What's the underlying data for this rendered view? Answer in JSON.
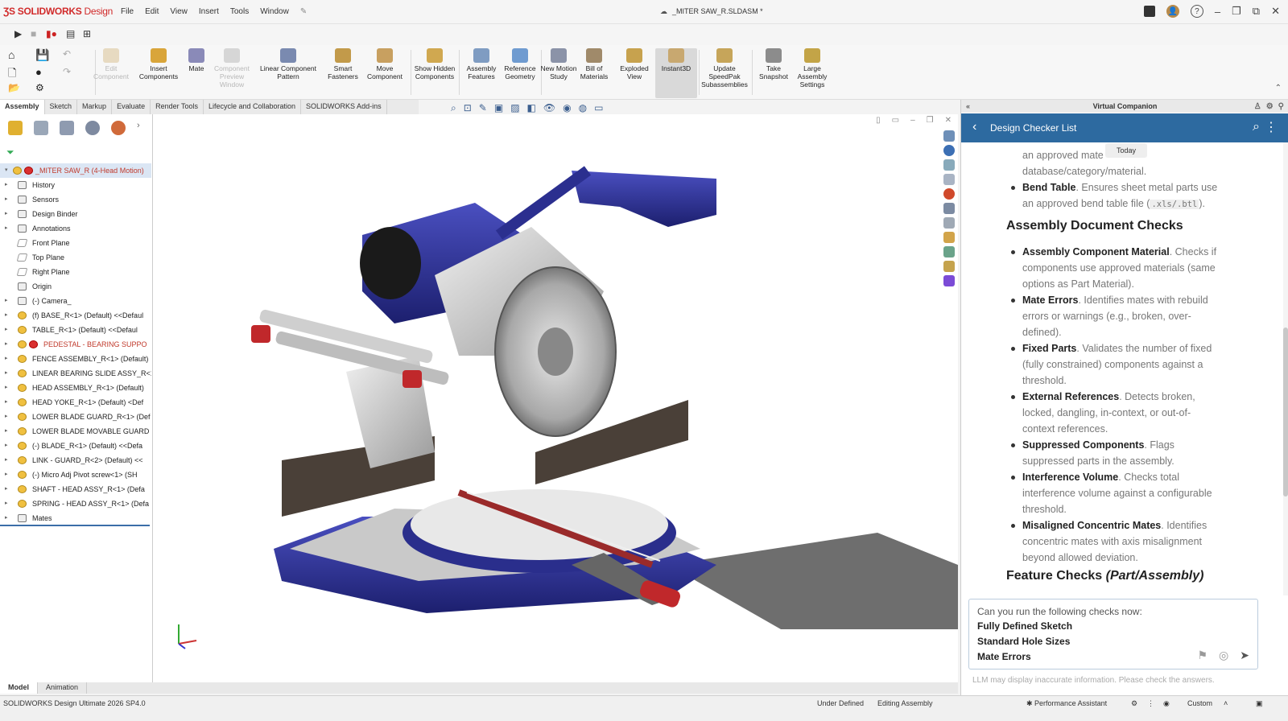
{
  "app": {
    "logo": "SOLIDWORKS",
    "logo_sub": "Design",
    "document_title": "_MITER SAW_R.SLDASM *"
  },
  "menu": [
    "File",
    "Edit",
    "View",
    "Insert",
    "Tools",
    "Window"
  ],
  "ribbon": [
    {
      "label": "Edit Component",
      "enabled": false
    },
    {
      "label": "Insert Components",
      "enabled": true
    },
    {
      "label": "Mate",
      "enabled": true
    },
    {
      "label": "Component Preview Window",
      "enabled": false
    },
    {
      "label": "Linear Component Pattern",
      "enabled": true
    },
    {
      "label": "Smart Fasteners",
      "enabled": true
    },
    {
      "label": "Move Component",
      "enabled": true
    },
    {
      "label": "Show Hidden Components",
      "enabled": true
    },
    {
      "label": "Assembly Features",
      "enabled": true
    },
    {
      "label": "Reference Geometry",
      "enabled": true
    },
    {
      "label": "New Motion Study",
      "enabled": true
    },
    {
      "label": "Bill of Materials",
      "enabled": true
    },
    {
      "label": "Exploded View",
      "enabled": true
    },
    {
      "label": "Instant3D",
      "enabled": true,
      "active": true
    },
    {
      "label": "Update SpeedPak Subassemblies",
      "enabled": true
    },
    {
      "label": "Take Snapshot",
      "enabled": true
    },
    {
      "label": "Large Assembly Settings",
      "enabled": true
    }
  ],
  "command_tabs": [
    "Assembly",
    "Sketch",
    "Markup",
    "Evaluate",
    "Render Tools",
    "Lifecycle and Collaboration",
    "SOLIDWORKS Add-ins"
  ],
  "tree": {
    "root": "_MITER SAW_R (4-Head Motion)",
    "items": [
      {
        "label": "History",
        "icon": "folder"
      },
      {
        "label": "Sensors",
        "icon": "folder"
      },
      {
        "label": "Design Binder",
        "icon": "folder"
      },
      {
        "label": "Annotations",
        "icon": "folder"
      },
      {
        "label": "Front Plane",
        "icon": "plane"
      },
      {
        "label": "Top Plane",
        "icon": "plane"
      },
      {
        "label": "Right Plane",
        "icon": "plane"
      },
      {
        "label": "Origin",
        "icon": "origin"
      },
      {
        "label": "(-) Camera_",
        "icon": "folder"
      },
      {
        "label": "(f) BASE_R<1> (Default) <<Defaul",
        "icon": "comp"
      },
      {
        "label": "TABLE_R<1> (Default) <<Defaul",
        "icon": "comp"
      },
      {
        "label": "PEDESTAL - BEARING SUPPO",
        "icon": "err",
        "error": true
      },
      {
        "label": "FENCE ASSEMBLY_R<1> (Default)",
        "icon": "comp"
      },
      {
        "label": "LINEAR BEARING SLIDE ASSY_R<1",
        "icon": "comp"
      },
      {
        "label": "HEAD ASSEMBLY_R<1> (Default)",
        "icon": "comp"
      },
      {
        "label": "HEAD YOKE_R<1> (Default) <Def",
        "icon": "comp"
      },
      {
        "label": "LOWER BLADE GUARD_R<1> (Def",
        "icon": "comp"
      },
      {
        "label": "LOWER BLADE MOVABLE GUARD",
        "icon": "comp"
      },
      {
        "label": "(-) BLADE_R<1> (Default) <<Defa",
        "icon": "comp"
      },
      {
        "label": "LINK - GUARD_R<2> (Default) <<",
        "icon": "comp"
      },
      {
        "label": "(-) Micro Adj Pivot screw<1> (SH",
        "icon": "comp"
      },
      {
        "label": "SHAFT - HEAD ASSY_R<1> (Defa",
        "icon": "comp"
      },
      {
        "label": "SPRING - HEAD ASSY_R<1> (Defa",
        "icon": "comp"
      },
      {
        "label": "Mates",
        "icon": "mates"
      }
    ]
  },
  "bottom_tabs": [
    "Model",
    "Animation"
  ],
  "status": {
    "product": "SOLIDWORKS Design Ultimate 2026 SP4.0",
    "state": "Under Defined",
    "mode": "Editing Assembly",
    "assistant": "Performance Assistant",
    "units": "Custom"
  },
  "companion": {
    "title": "Virtual Companion",
    "header": "Design Checker List",
    "today_badge": "Today",
    "content": {
      "top_line1": "an approved mate",
      "top_line2": "database/category/material.",
      "bend_table_label": "Bend Table",
      "bend_table_text1": ". Ensures sheet metal parts use",
      "bend_table_text2": "an approved bend table file (",
      "bend_table_code": ".xls/.btl",
      "bend_table_text3": ").",
      "h_assembly": "Assembly Document Checks",
      "items": [
        {
          "label": "Assembly Component Material",
          "lines": [
            ". Checks if",
            "components use approved materials (same",
            "options as Part Material)."
          ]
        },
        {
          "label": "Mate Errors",
          "lines": [
            ". Identifies mates with rebuild",
            "errors or warnings (e.g., broken, over-",
            "defined)."
          ]
        },
        {
          "label": "Fixed Parts",
          "lines": [
            ". Validates the number of fixed",
            "(fully constrained) components against a",
            "threshold."
          ]
        },
        {
          "label": "External References",
          "lines": [
            ". Detects broken,",
            "locked, dangling, in-context, or out-of-",
            "context references."
          ]
        },
        {
          "label": "Suppressed Components",
          "lines": [
            ". Flags",
            "suppressed parts in the assembly."
          ]
        },
        {
          "label": "Interference Volume",
          "lines": [
            ". Checks total",
            "interference volume against a configurable",
            "threshold."
          ]
        },
        {
          "label": "Misaligned Concentric Mates",
          "lines": [
            ". Identifies",
            "concentric mates with axis misalignment",
            "beyond allowed deviation."
          ]
        }
      ],
      "h_feature": "Feature Checks ",
      "h_feature_em": "(Part/Assembly)"
    },
    "input_lines": [
      "Can you run the following checks now:",
      "Fully Defined Sketch",
      "Standard Hole Sizes",
      "Mate Errors"
    ],
    "disclaimer": "LLM may display inaccurate information. Please check the answers."
  },
  "colors": {
    "accent": "#2d6aa0",
    "brand": "#d12b2b",
    "model_blue": "#2b2f8f"
  }
}
